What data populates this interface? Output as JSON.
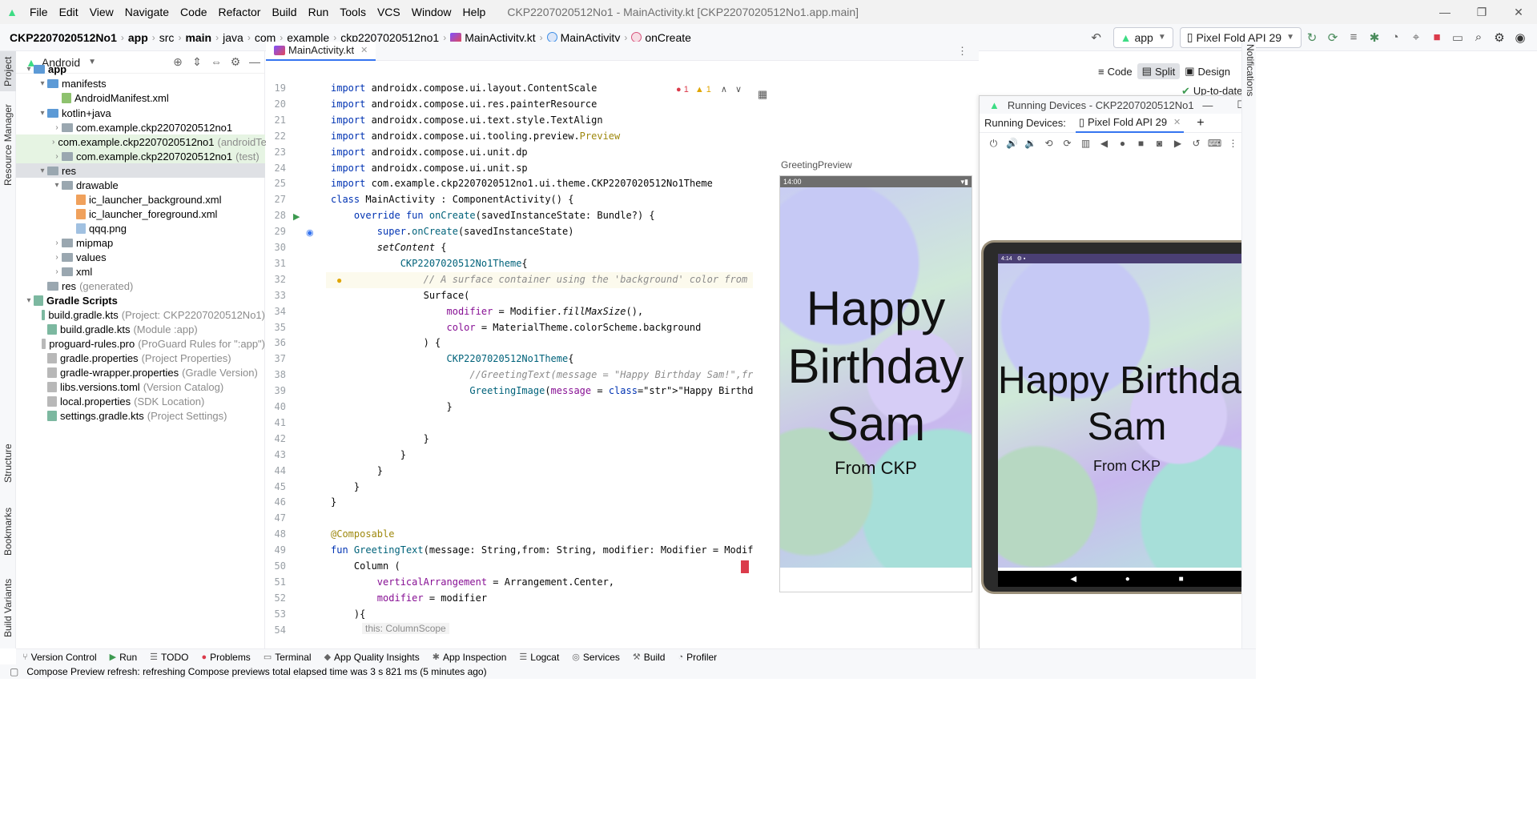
{
  "menu": [
    "File",
    "Edit",
    "View",
    "Navigate",
    "Code",
    "Refactor",
    "Build",
    "Run",
    "Tools",
    "VCS",
    "Window",
    "Help"
  ],
  "window_title": "CKP2207020512No1 - MainActivity.kt [CKP2207020512No1.app.main]",
  "breadcrumb": [
    "CKP2207020512No1",
    "app",
    "src",
    "main",
    "java",
    "com",
    "example",
    "ckp2207020512no1",
    "MainActivity.kt",
    "MainActivity",
    "onCreate"
  ],
  "toolbar": {
    "config": "app",
    "device": "Pixel Fold API 29"
  },
  "project_panel": {
    "view": "Android",
    "tree": [
      {
        "label": "app",
        "hint": ""
      },
      {
        "label": "manifests",
        "hint": ""
      },
      {
        "label": "AndroidManifest.xml",
        "hint": ""
      },
      {
        "label": "kotlin+java",
        "hint": ""
      },
      {
        "label": "com.example.ckp2207020512no1",
        "hint": ""
      },
      {
        "label": "com.example.ckp2207020512no1",
        "hint": "(androidTest)"
      },
      {
        "label": "com.example.ckp2207020512no1",
        "hint": "(test)"
      },
      {
        "label": "res",
        "hint": ""
      },
      {
        "label": "drawable",
        "hint": ""
      },
      {
        "label": "ic_launcher_background.xml",
        "hint": ""
      },
      {
        "label": "ic_launcher_foreground.xml",
        "hint": ""
      },
      {
        "label": "qqq.png",
        "hint": ""
      },
      {
        "label": "mipmap",
        "hint": ""
      },
      {
        "label": "values",
        "hint": ""
      },
      {
        "label": "xml",
        "hint": ""
      },
      {
        "label": "res",
        "hint": "(generated)"
      },
      {
        "label": "Gradle Scripts",
        "hint": ""
      },
      {
        "label": "build.gradle.kts",
        "hint": "(Project: CKP2207020512No1)"
      },
      {
        "label": "build.gradle.kts",
        "hint": "(Module :app)"
      },
      {
        "label": "proguard-rules.pro",
        "hint": "(ProGuard Rules for \":app\")"
      },
      {
        "label": "gradle.properties",
        "hint": "(Project Properties)"
      },
      {
        "label": "gradle-wrapper.properties",
        "hint": "(Gradle Version)"
      },
      {
        "label": "libs.versions.toml",
        "hint": "(Version Catalog)"
      },
      {
        "label": "local.properties",
        "hint": "(SDK Location)"
      },
      {
        "label": "settings.gradle.kts",
        "hint": "(Project Settings)"
      }
    ]
  },
  "left_tabs": [
    "Project",
    "Resource Manager",
    "Structure",
    "Bookmarks",
    "Build Variants"
  ],
  "editor": {
    "tab": "MainActivity.kt",
    "inspections": {
      "errors": "1",
      "warnings": "1"
    },
    "line_numbers": [
      "19",
      "20",
      "21",
      "22",
      "23",
      "24",
      "25",
      "27",
      "28",
      "29",
      "30",
      "31",
      "32",
      "33",
      "34",
      "35",
      "36",
      "37",
      "38",
      "39",
      "40",
      "41",
      "42",
      "43",
      "44",
      "45",
      "46",
      "47",
      "48",
      "49",
      "50",
      "51",
      "52",
      "53",
      "54"
    ],
    "lines": [
      "import androidx.compose.ui.layout.ContentScale",
      "import androidx.compose.ui.res.painterResource",
      "import androidx.compose.ui.text.style.TextAlign",
      "import androidx.compose.ui.tooling.preview.Preview",
      "import androidx.compose.ui.unit.dp",
      "import androidx.compose.ui.unit.sp",
      "import com.example.ckp2207020512no1.ui.theme.CKP2207020512No1Theme",
      "class MainActivity : ComponentActivity() {",
      "    override fun onCreate(savedInstanceState: Bundle?) {",
      "        super.onCreate(savedInstanceState)",
      "        setContent {",
      "            CKP2207020512No1Theme {",
      "                // A surface container using the 'background' color from the them",
      "                Surface(",
      "                    modifier = Modifier.fillMaxSize(),",
      "                    color = MaterialTheme.colorScheme.background",
      "                ) {",
      "                    CKP2207020512No1Theme{",
      "                        //GreetingText(message = \"Happy Birthday Sam!\",from = \"Fr",
      "                        GreetingImage(message = \"Happy Birthday Sam\",from = \"From",
      "                    }",
      "",
      "                }",
      "            }",
      "        }",
      "    }",
      "}",
      "",
      "@Composable",
      "fun GreetingText(message: String,from: String, modifier: Modifier = Modifier){",
      "    Column (",
      "        verticalArrangement = Arrangement.Center,",
      "        modifier = modifier",
      "    ){",
      ""
    ],
    "inlay_hint": "this: ColumnScope"
  },
  "design": {
    "modes": [
      "Code",
      "Split",
      "Design"
    ],
    "active_mode": "Split",
    "status": "Up-to-date",
    "preview_label": "GreetingPreview",
    "preview_time": "14:00",
    "greeting": [
      "Happy",
      "Birthday",
      "Sam"
    ],
    "from": "From CKP"
  },
  "running_devices": {
    "title": "Running Devices - CKP2207020512No1",
    "label": "Running Devices:",
    "tab": "Pixel Fold API 29",
    "device_time": "4:14",
    "greeting_line1": "Happy Birthday",
    "greeting_line2": "Sam",
    "from": "From CKP"
  },
  "right_tab": "Notifications",
  "bottom_tools": [
    "Version Control",
    "Run",
    "TODO",
    "Problems",
    "Terminal",
    "App Quality Insights",
    "App Inspection",
    "Logcat",
    "Services",
    "Build",
    "Profiler"
  ],
  "status_message": "Compose Preview refresh: refreshing Compose previews total elapsed time was 3 s 821 ms (5 minutes ago)"
}
